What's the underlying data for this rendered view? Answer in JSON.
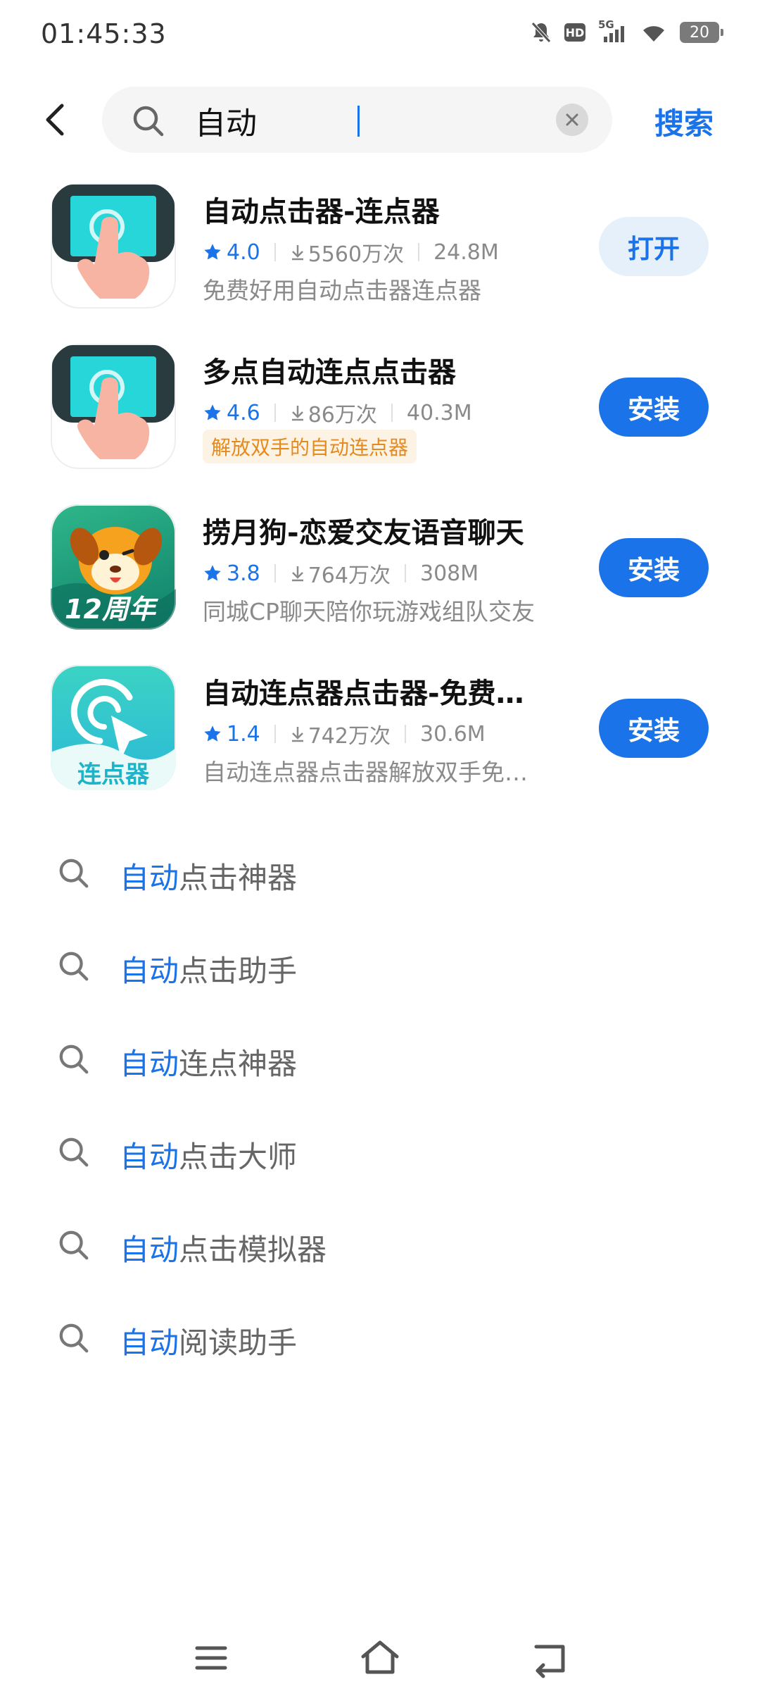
{
  "status_bar": {
    "time": "01:45:33",
    "network_label": "5G",
    "hd_label": "HD",
    "battery_level": "20"
  },
  "search": {
    "query": "自动",
    "submit_label": "搜索"
  },
  "apps": [
    {
      "name": "自动点击器-连点器",
      "rating": "4.0",
      "downloads": "5560万次",
      "size": "24.8M",
      "desc": "免费好用自动点击器连点器",
      "tag": "",
      "action": "打开",
      "icon": "hand-tap-icon"
    },
    {
      "name": "多点自动连点点击器",
      "rating": "4.6",
      "downloads": "86万次",
      "size": "40.3M",
      "desc": "",
      "tag": "解放双手的自动连点器",
      "action": "安装",
      "icon": "hand-tap-icon"
    },
    {
      "name": "捞月狗-恋爱交友语音聊天",
      "rating": "3.8",
      "downloads": "764万次",
      "size": "308M",
      "desc": "同城CP聊天陪你玩游戏组队交友",
      "tag": "",
      "action": "安装",
      "icon": "dog-mascot-icon",
      "icon_text": "12周年"
    },
    {
      "name": "自动连点器点击器-免费…",
      "rating": "1.4",
      "downloads": "742万次",
      "size": "30.6M",
      "desc": "自动连点器点击器解放双手免…",
      "tag": "",
      "action": "安装",
      "icon": "cursor-click-icon",
      "icon_text": "连点器"
    }
  ],
  "suggestions": [
    {
      "prefix": "自动",
      "rest": "点击神器"
    },
    {
      "prefix": "自动",
      "rest": "点击助手"
    },
    {
      "prefix": "自动",
      "rest": "连点神器"
    },
    {
      "prefix": "自动",
      "rest": "点击大师"
    },
    {
      "prefix": "自动",
      "rest": "点击模拟器"
    },
    {
      "prefix": "自动",
      "rest": "阅读助手"
    }
  ],
  "colors": {
    "accent": "#1a73e8",
    "tag_orange": "#e58a1f",
    "muted": "#8a8a8a"
  }
}
